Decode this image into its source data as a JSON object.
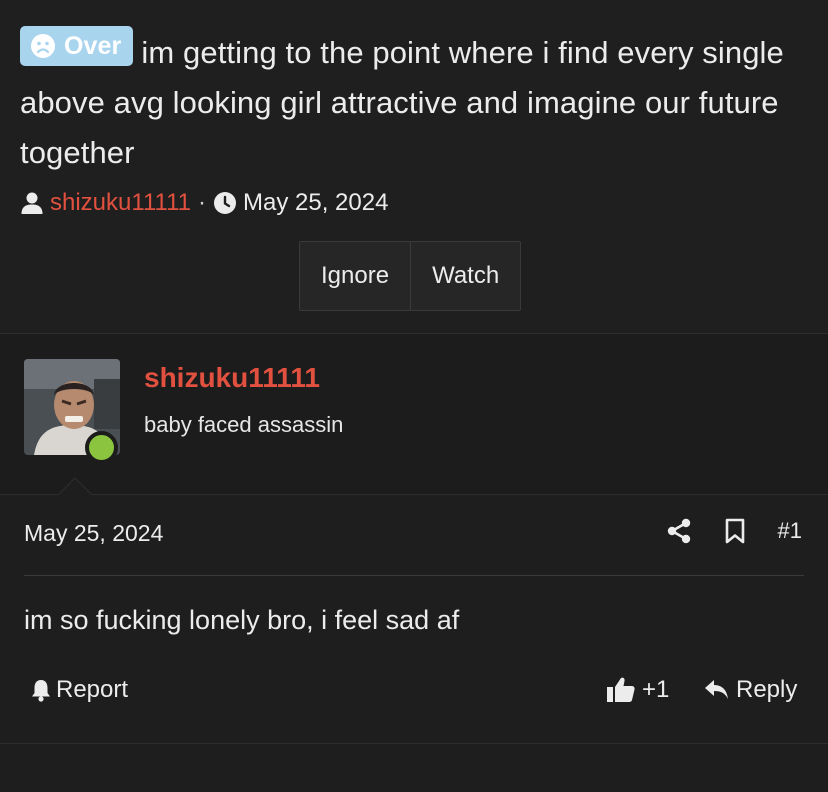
{
  "thread": {
    "prefix": "Over",
    "prefix_color": "#a9d4ee",
    "title": "im getting to the point where i find every single above avg looking girl attractive and imagine our future together",
    "author": "shizuku11111",
    "separator": "·",
    "date": "May 25, 2024",
    "buttons": {
      "ignore": "Ignore",
      "watch": "Watch"
    }
  },
  "post": {
    "username": "shizuku11111",
    "user_title": "baby faced assassin",
    "online_status_color": "#8bc53f",
    "date": "May 25, 2024",
    "number": "#1",
    "body": "im so fucking lonely bro, i feel sad af",
    "report_label": "Report",
    "reaction_count": "+1",
    "reply_label": "Reply",
    "icons": [
      "sad-face-icon",
      "user-icon",
      "clock-icon",
      "share-icon",
      "bookmark-icon",
      "bell-icon",
      "thumbs-up-icon",
      "reply-arrow-icon"
    ]
  },
  "colors": {
    "background": "#1e1e1e",
    "accent_username": "#e2513f",
    "text": "#ececec"
  }
}
